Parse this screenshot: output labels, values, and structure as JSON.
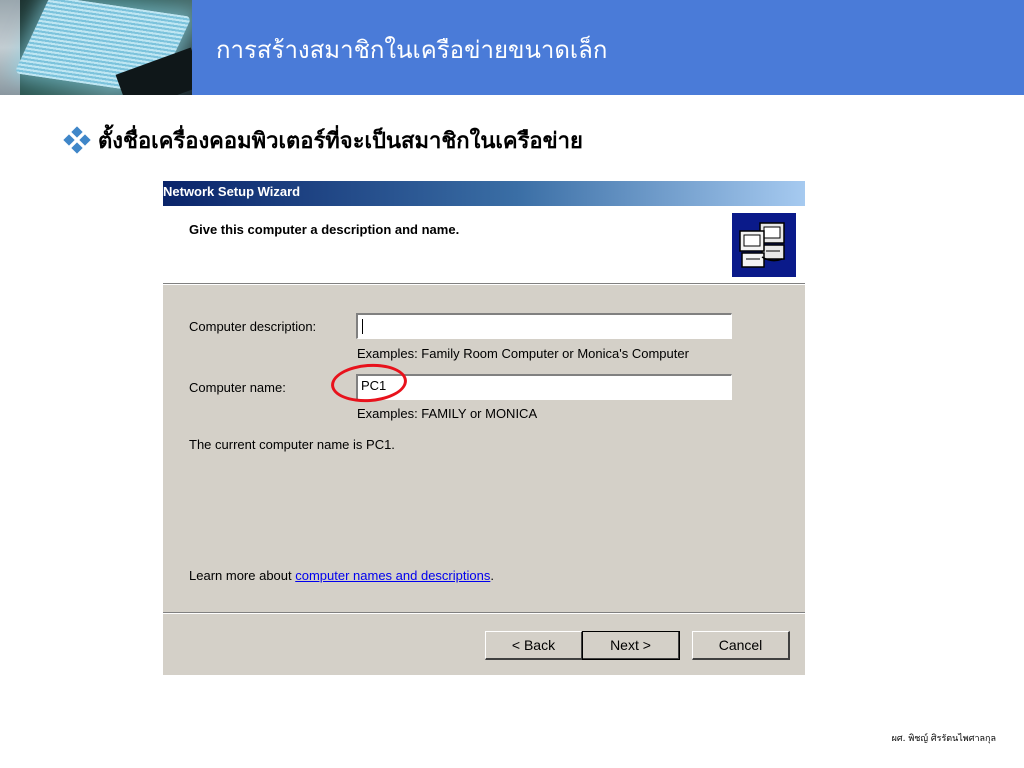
{
  "slide": {
    "title": "การสร้างสมาชิกในเครือข่ายขนาดเล็ก",
    "bullet_text": "ตั้งชื่อเครื่องคอมพิวเตอร์ที่จะเป็นสมาชิกในเครือข่าย",
    "footer": "ผศ. พิชญ์ ศิรรัตนไพศาลกุล",
    "accent_color": "#4a7bd8",
    "bullet_color": "#3f86c8"
  },
  "wizard": {
    "title": "Network Setup Wizard",
    "heading": "Give this computer a description and name.",
    "graphic": "network-computers-icon",
    "computer_description": {
      "label": "Computer description:",
      "value": "",
      "example": "Examples: Family Room Computer or Monica's Computer"
    },
    "computer_name": {
      "label": "Computer name:",
      "value": "PC1",
      "example": "Examples: FAMILY or MONICA"
    },
    "current_name_text": "The current computer name is PC1.",
    "learn_more": {
      "prefix": "Learn more about ",
      "link": "computer names and descriptions",
      "suffix": "."
    },
    "buttons": {
      "back": "< Back",
      "next": "Next >",
      "cancel": "Cancel"
    },
    "highlight_color": "#e8121c"
  }
}
